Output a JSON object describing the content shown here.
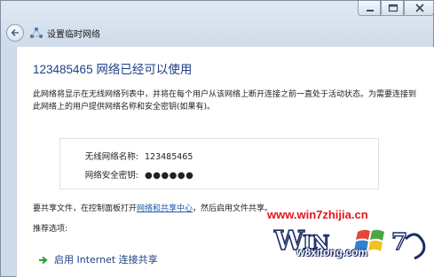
{
  "window": {
    "title": "设置临时网络",
    "controls": [
      "minimize-icon",
      "maximize-icon",
      "close-icon"
    ]
  },
  "main": {
    "heading": "123485465 网络已经可以使用",
    "description": "此网络将显示在无线网络列表中，并将在每个用户从该网络上断开连接之前一直处于活动状态。为需要连接到此网络上的用户提供网络名称和安全密钥(如果有)。",
    "network_name_label": "无线网络名称:",
    "network_name_value": "123485465",
    "security_key_label": "网络安全密钥:",
    "security_key_value": "●●●●●●",
    "share_prefix": "要共享文件，在控制面板打开",
    "share_link": "网络和共享中心",
    "share_suffix": "，然后启用文件共享。",
    "recommended_label": "推荐选项:",
    "option_label": "启用 Internet 连接共享"
  },
  "watermark": {
    "url": "www.win7zhijia.cn",
    "logo_text": "Win7",
    "sub_text": "w8xitong.com"
  },
  "colors": {
    "heading": "#1e3f87",
    "link": "#1d56b0",
    "option_arrow": "#2e9a3a",
    "watermark_red": "#e4141a",
    "watermark_blue": "#1a2c66"
  }
}
